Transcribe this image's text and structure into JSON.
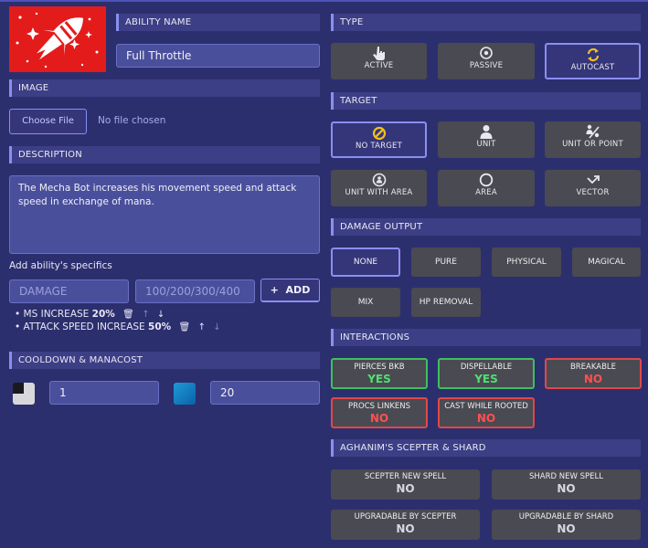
{
  "ability": {
    "name_label": "ABILITY NAME",
    "name_value": "Full Throttle"
  },
  "image": {
    "header": "IMAGE",
    "choose_label": "Choose File",
    "status": "No file chosen"
  },
  "description": {
    "header": "DESCRIPTION",
    "text": "The Mecha Bot increases his movement speed and attack speed in exchange of mana."
  },
  "specifics": {
    "title": "Add ability's specifics",
    "label_placeholder": "DAMAGE",
    "value_placeholder": "100/200/300/400",
    "add_label": "+  ADD",
    "items": [
      {
        "label": "MS INCREASE",
        "value": "20%"
      },
      {
        "label": "ATTACK SPEED INCREASE",
        "value": "50%"
      }
    ]
  },
  "cooldown": {
    "header": "COOLDOWN & MANACOST",
    "cooldown_value": "1",
    "manacost_value": "20"
  },
  "type": {
    "header": "TYPE",
    "options": [
      {
        "label": "ACTIVE",
        "icon": "hand-pointer-icon"
      },
      {
        "label": "PASSIVE",
        "icon": "target-icon"
      },
      {
        "label": "AUTOCAST",
        "icon": "refresh-icon"
      }
    ],
    "selected": "AUTOCAST"
  },
  "target": {
    "header": "TARGET",
    "options": [
      {
        "label": "NO TARGET",
        "icon": "no-target-icon"
      },
      {
        "label": "UNIT",
        "icon": "user-icon"
      },
      {
        "label": "UNIT OR POINT",
        "icon": "unit-or-point-icon"
      },
      {
        "label": "UNIT WITH AREA",
        "icon": "unit-with-area-icon"
      },
      {
        "label": "AREA",
        "icon": "circle-icon"
      },
      {
        "label": "VECTOR",
        "icon": "vector-icon"
      }
    ],
    "selected": "NO TARGET"
  },
  "damage": {
    "header": "DAMAGE OUTPUT",
    "options": [
      "NONE",
      "PURE",
      "PHYSICAL",
      "MAGICAL",
      "MIX",
      "HP REMOVAL"
    ],
    "selected": "NONE"
  },
  "interactions": {
    "header": "INTERACTIONS",
    "items": [
      {
        "label": "PIERCES BKB",
        "value": "YES"
      },
      {
        "label": "DISPELLABLE",
        "value": "YES"
      },
      {
        "label": "BREAKABLE",
        "value": "NO"
      },
      {
        "label": "PROCS LINKENS",
        "value": "NO"
      },
      {
        "label": "CAST WHILE ROOTED",
        "value": "NO"
      }
    ]
  },
  "aghanim": {
    "header": "AGHANIM'S SCEPTER & SHARD",
    "items": [
      {
        "label": "SCEPTER NEW SPELL",
        "value": "NO"
      },
      {
        "label": "SHARD NEW SPELL",
        "value": "NO"
      },
      {
        "label": "UPGRADABLE BY SCEPTER",
        "value": "NO"
      },
      {
        "label": "UPGRADABLE BY SHARD",
        "value": "NO"
      }
    ]
  },
  "colors": {
    "background": "#2c2f6e",
    "accent": "#8b8ff0",
    "yes": "#4fe070",
    "no": "#ff5050",
    "icon_yellow": "#f0c020"
  }
}
